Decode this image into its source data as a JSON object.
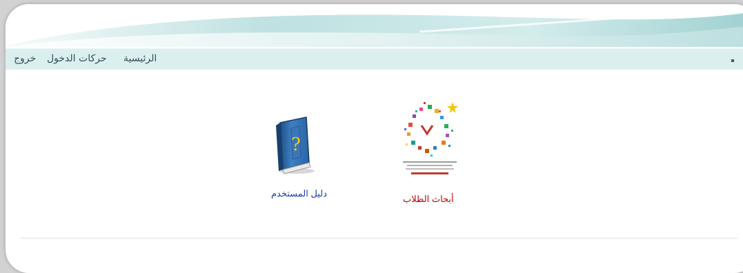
{
  "nav": {
    "items": [
      {
        "label": "الرئيسية"
      },
      {
        "label": "حركات الدخول"
      },
      {
        "label": "خروج"
      }
    ]
  },
  "tiles": [
    {
      "label": "أبحاث الطلاب",
      "icon": "research-logo-icon",
      "label_color": "#c00000"
    },
    {
      "label": "دليل المستخدم",
      "icon": "help-book-icon",
      "label_color": "#1a3aa8"
    }
  ],
  "colors": {
    "nav_bg": "#dcefef",
    "banner_teal": "#a9d5d5",
    "frame_bg": "#ffffff"
  }
}
